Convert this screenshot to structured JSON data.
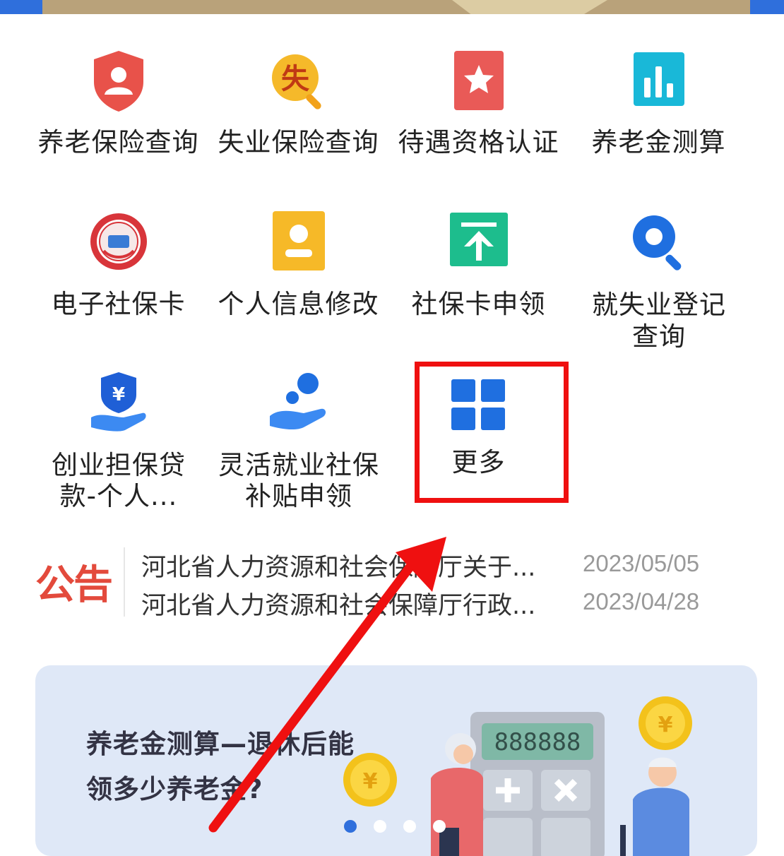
{
  "services": [
    {
      "label": "养老保险查询",
      "icon": "pension-shield-icon"
    },
    {
      "label": "失业保险查询",
      "icon": "unemployment-search-icon",
      "glyph": "失"
    },
    {
      "label": "待遇资格认证",
      "icon": "star-badge-icon"
    },
    {
      "label": "养老金测算",
      "icon": "bar-chart-icon"
    },
    {
      "label": "电子社保卡",
      "icon": "social-security-card-icon"
    },
    {
      "label": "个人信息修改",
      "icon": "person-card-icon"
    },
    {
      "label": "社保卡申领",
      "icon": "upload-arrow-icon"
    },
    {
      "label": "就失业登记查询",
      "icon": "search-icon"
    },
    {
      "label": "创业担保贷款-个人...",
      "icon": "yen-hand-icon",
      "glyph": "¥"
    },
    {
      "label": "灵活就业社保补贴申领",
      "icon": "hand-coin-icon"
    },
    {
      "label": "更多",
      "icon": "grid-more-icon"
    }
  ],
  "notice": {
    "tag": "公告",
    "items": [
      {
        "title": "河北省人力资源和社会保障厅关于...",
        "date": "2023/05/05"
      },
      {
        "title": "河北省人力资源和社会保障厅行政...",
        "date": "2023/04/28"
      }
    ]
  },
  "banner": {
    "line1": "养老金测算—退休后能",
    "line2": "领多少养老金?",
    "calculator_display": "888888",
    "coin_glyph": "¥",
    "active_slide": 1,
    "slide_count": 4
  },
  "colors": {
    "accent_blue": "#2f6fdc",
    "highlight_red": "#ef1010",
    "notice_red": "#e34a3c"
  }
}
